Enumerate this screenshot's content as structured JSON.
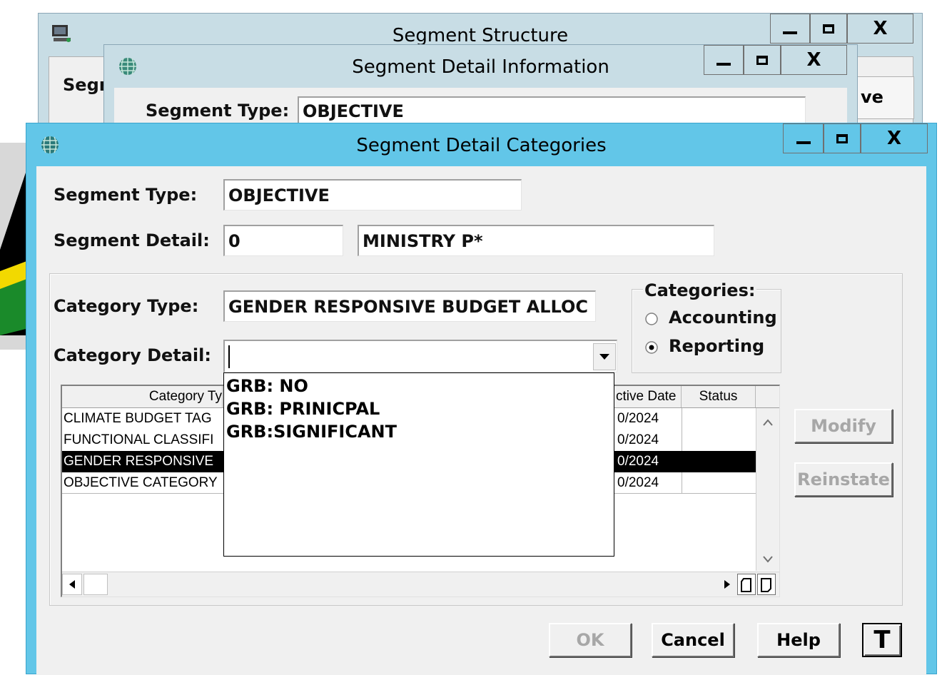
{
  "windows": {
    "structure": {
      "title": "Segment Structure",
      "label_partial": "Segr",
      "right_partial": "ve"
    },
    "detail_info": {
      "title": "Segment Detail Information",
      "segment_type_label": "Segment Type:",
      "segment_type_value": "OBJECTIVE"
    },
    "categories": {
      "title": "Segment Detail Categories"
    }
  },
  "window_controls": {
    "minimize": "minimize",
    "maximize": "maximize",
    "close": "X"
  },
  "form": {
    "segment_type_label": "Segment Type:",
    "segment_type_value": "OBJECTIVE",
    "segment_detail_label": "Segment Detail:",
    "segment_detail_code": "0",
    "segment_detail_name": "MINISTRY P*",
    "category_type_label": "Category Type:",
    "category_type_value": "GENDER RESPONSIVE BUDGET ALLOC",
    "category_detail_label": "Category Detail:",
    "category_detail_value": ""
  },
  "categories_group": {
    "legend": "Categories:",
    "options": [
      {
        "label": "Accounting",
        "selected": false
      },
      {
        "label": "Reporting",
        "selected": true
      }
    ]
  },
  "dropdown_options": [
    "GRB: NO",
    "GRB: PRINICPAL",
    "GRB:SIGNIFICANT"
  ],
  "grid": {
    "headers": {
      "category_type": "Category Ty",
      "effective_date": "ctive Date",
      "status": "Status"
    },
    "rows": [
      {
        "category": "CLIMATE BUDGET TAG",
        "date": "0/2024",
        "status": "",
        "selected": false
      },
      {
        "category": "FUNCTIONAL CLASSIFI",
        "date": "0/2024",
        "status": "",
        "selected": false
      },
      {
        "category": "GENDER RESPONSIVE ",
        "date": "0/2024",
        "status": "",
        "selected": true
      },
      {
        "category": "OBJECTIVE CATEGORY",
        "date": "0/2024",
        "status": "",
        "selected": false
      }
    ]
  },
  "buttons": {
    "modify": "Modify",
    "reinstate": "Reinstate",
    "ok": "OK",
    "cancel": "Cancel",
    "help": "Help",
    "toolbar_t": "T"
  },
  "colors": {
    "active_titlebar": "#62c6e8",
    "inactive_titlebar": "#c6dce4",
    "dialog_bg": "#f0f0f0",
    "selection_bg": "#000000",
    "selection_fg": "#ffffff"
  }
}
